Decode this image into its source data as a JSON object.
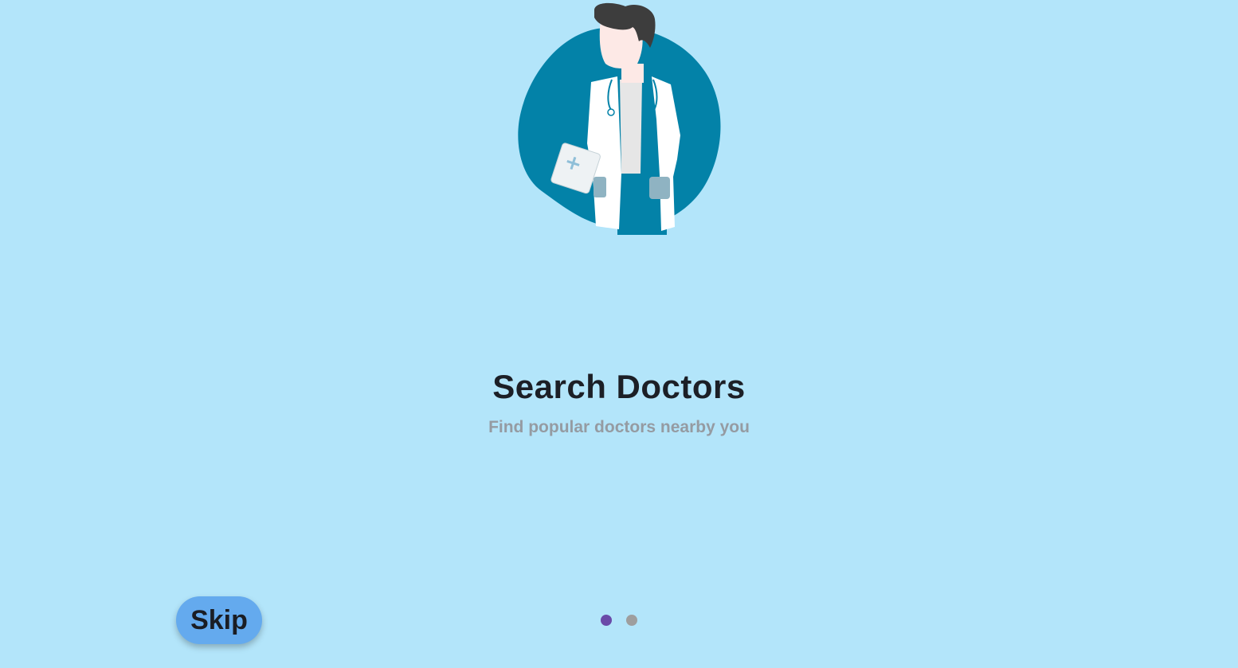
{
  "onboarding": {
    "title": "Search Doctors",
    "subtitle": "Find popular doctors nearby you",
    "illustration_icon": "doctor-illustration",
    "skip_label": "Skip",
    "pager": {
      "total": 2,
      "current": 1,
      "active_color": "#6a4aa8",
      "inactive_color": "#9e9e9e"
    }
  },
  "colors": {
    "background": "#b3e5fa",
    "blob": "#0382a8",
    "skip_button": "#64aaee",
    "title": "#1c1f26",
    "subtitle": "#959ba2"
  }
}
